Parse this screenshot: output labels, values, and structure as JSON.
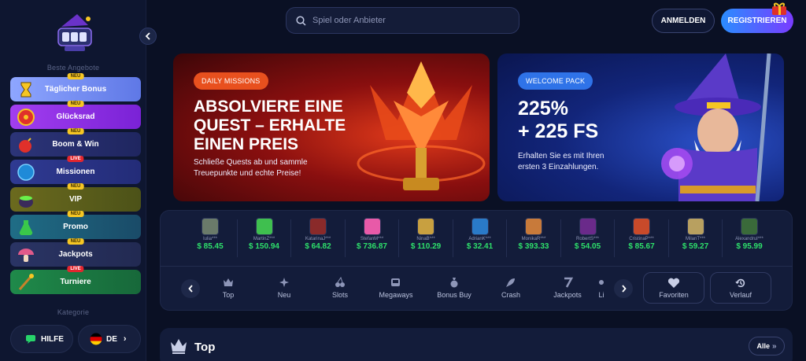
{
  "sidebar": {
    "section_offers": "Beste Angebote",
    "section_category": "Kategorie",
    "items": [
      {
        "label": "Täglicher Bonus",
        "badge": "NEU",
        "color": "#6f8dff"
      },
      {
        "label": "Glücksrad",
        "badge": "NEU",
        "color": "#8a2be2"
      },
      {
        "label": "Boom & Win",
        "badge": "NEU",
        "color": "#2a2f6a"
      },
      {
        "label": "Missionen",
        "badge": "LIVE",
        "color": "#2c3580"
      },
      {
        "label": "VIP",
        "badge": "NEU",
        "color": "#5a6020"
      },
      {
        "label": "Promo",
        "badge": "NEU",
        "color": "#1d5a6e"
      },
      {
        "label": "Jackpots",
        "badge": "NEU",
        "color": "#263058"
      },
      {
        "label": "Turniere",
        "badge": "LIVE",
        "color": "#1d6a45"
      }
    ],
    "help_label": "HILFE",
    "lang_label": "DE"
  },
  "header": {
    "search_placeholder": "Spiel oder Anbieter",
    "login_label": "ANMELDEN",
    "register_label": "REGISTRIEREN"
  },
  "banners": {
    "left": {
      "pill": "DAILY MISSIONS",
      "title": "ABSOLVIERE EINE\nQUEST – ERHALTE\nEINEN PREIS",
      "text": "Schließe Quests ab und sammle\nTreuepunkte und echte Preise!"
    },
    "right": {
      "pill": "WELCOME PACK",
      "title": "225%\n+ 225 FS",
      "text": "Erhalten Sie es mit Ihren\nersten 3 Einzahlungen."
    }
  },
  "winners": [
    {
      "name": "Iulia***",
      "amount": "$ 85.45",
      "color": "#6a7a6a"
    },
    {
      "name": "MartinZ***",
      "amount": "$ 150.94",
      "color": "#3fbf4f"
    },
    {
      "name": "KatarinaJ***",
      "amount": "$ 64.82",
      "color": "#8a2a2a"
    },
    {
      "name": "StefanM***",
      "amount": "$ 736.87",
      "color": "#e85aa8"
    },
    {
      "name": "NinaB***",
      "amount": "$ 110.29",
      "color": "#c8a040"
    },
    {
      "name": "AdrianK***",
      "amount": "$ 32.41",
      "color": "#2a7ac8"
    },
    {
      "name": "MonikaR***",
      "amount": "$ 393.33",
      "color": "#c87a3a"
    },
    {
      "name": "RobertS***",
      "amount": "$ 54.05",
      "color": "#6a2a8a"
    },
    {
      "name": "CristinaP***",
      "amount": "$ 85.67",
      "color": "#c84a2a"
    },
    {
      "name": "MilanT***",
      "amount": "$ 59.27",
      "color": "#b8a060"
    },
    {
      "name": "AlexandruI***",
      "amount": "$ 95.99",
      "color": "#3a6a3a"
    }
  ],
  "categories": [
    {
      "label": "Top",
      "icon": "crown-icon"
    },
    {
      "label": "Neu",
      "icon": "sparkle-icon"
    },
    {
      "label": "Slots",
      "icon": "cherry-icon"
    },
    {
      "label": "Megaways",
      "icon": "slot-machine-icon"
    },
    {
      "label": "Bonus Buy",
      "icon": "money-bag-icon"
    },
    {
      "label": "Crash",
      "icon": "rocket-icon"
    },
    {
      "label": "Jackpots",
      "icon": "seven-icon"
    },
    {
      "label": "Li",
      "icon": "live-icon"
    }
  ],
  "favorites_label": "Favoriten",
  "history_label": "Verlauf",
  "top_section": {
    "title": "Top",
    "all_label": "Alle"
  }
}
